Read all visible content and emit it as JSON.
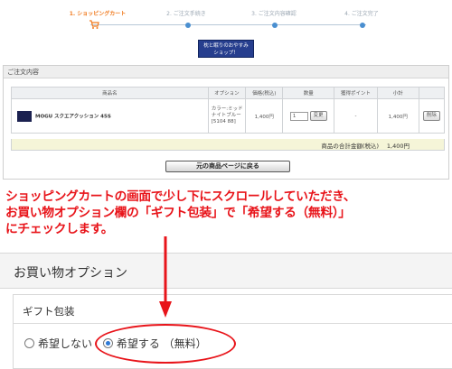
{
  "steps": [
    {
      "label": "1. ショッピングカート",
      "active": true
    },
    {
      "label": "2. ご注文手続き",
      "active": false
    },
    {
      "label": "3. ご注文内容確認",
      "active": false
    },
    {
      "label": "4. ご注文完了",
      "active": false
    }
  ],
  "promo_banner": {
    "line1": "枕と眠りのおやすみ",
    "line2": "ショップ！"
  },
  "order_panel": {
    "title": "ご注文内容",
    "columns": [
      "商品名",
      "オプション",
      "価格(税込)",
      "数量",
      "獲得ポイント",
      "小計",
      ""
    ],
    "rows": [
      {
        "name": "MOGU スクエアクッション 45S",
        "option": "カラー:ミッドナイトブルー[5104 88]",
        "price": "1,400円",
        "quantity": "1",
        "change_label": "変更",
        "points": "-",
        "subtotal": "1,400円",
        "delete_label": "削除"
      }
    ],
    "total_label": "商品の合計金額(税込)",
    "total_value": "1,400円",
    "back_button": "元の商品ページに戻る"
  },
  "instruction": {
    "line1": "ショッピングカートの画面で少し下にスクロールしていただき、",
    "line2": "お買い物オプション欄の「ギフト包装」で「希望する（無料）」",
    "line3": "にチェックします。"
  },
  "shopping_option": {
    "title": "お買い物オプション",
    "gift_title": "ギフト包装",
    "options": [
      {
        "label": "希望しない",
        "checked": false
      },
      {
        "label": "希望する （無料）",
        "checked": true
      }
    ]
  },
  "colors": {
    "accent": "#f07a1e",
    "annotation": "#e8141a",
    "radio_selected": "#2f7ad6"
  }
}
